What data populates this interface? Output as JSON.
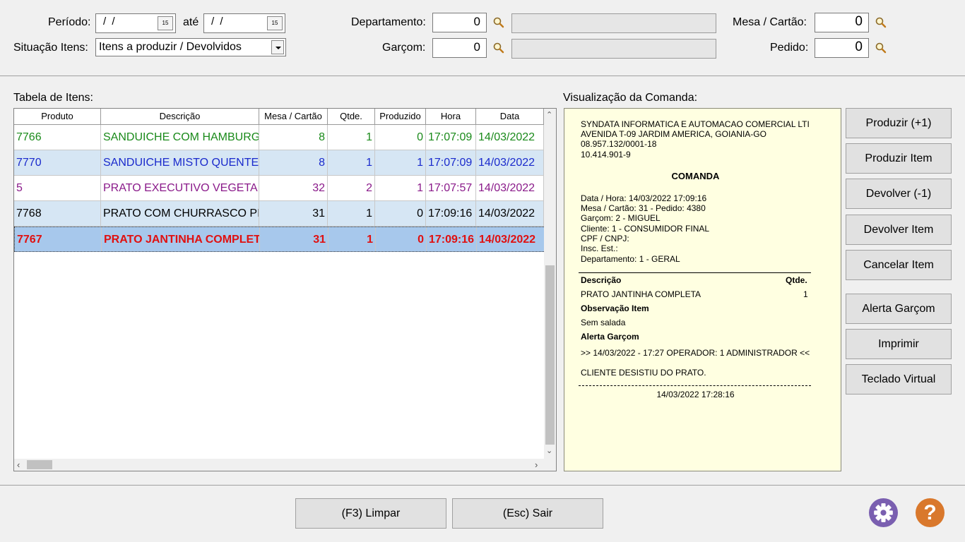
{
  "filters": {
    "periodo_label": "Período:",
    "ate_label": "até",
    "date_from": "/ /",
    "date_to": "/ /",
    "cal_icon_text": "15",
    "situacao_label": "Situação Itens:",
    "situacao_value": "Itens a produzir / Devolvidos",
    "departamento_label": "Departamento:",
    "departamento_value": "0",
    "garcom_label": "Garçom:",
    "garcom_value": "0",
    "mesa_label": "Mesa / Cartão:",
    "mesa_value": "0",
    "pedido_label": "Pedido:",
    "pedido_value": "0"
  },
  "table": {
    "title": "Tabela de Itens:",
    "columns": [
      "Produto",
      "Descrição",
      "Mesa / Cartão",
      "Qtde.",
      "Produzido",
      "Hora",
      "Data"
    ],
    "rows": [
      {
        "produto": "7766",
        "descricao": "SANDUICHE COM HAMBURGUER",
        "mesa": "8",
        "qtde": "1",
        "produzido": "0",
        "hora": "17:07:09",
        "data": "14/03/2022",
        "color": "#1a8a1a"
      },
      {
        "produto": "7770",
        "descricao": "SANDUICHE MISTO QUENTE",
        "mesa": "8",
        "qtde": "1",
        "produzido": "1",
        "hora": "17:07:09",
        "data": "14/03/2022",
        "color": "#1a2acc"
      },
      {
        "produto": "5",
        "descricao": "PRATO EXECUTIVO VEGETARIANO",
        "mesa": "32",
        "qtde": "2",
        "produzido": "1",
        "hora": "17:07:57",
        "data": "14/03/2022",
        "color": "#8a1a8a"
      },
      {
        "produto": "7768",
        "descricao": "PRATO COM CHURRASCO PICANHA",
        "mesa": "31",
        "qtde": "1",
        "produzido": "0",
        "hora": "17:09:16",
        "data": "14/03/2022",
        "color": "#000000"
      },
      {
        "produto": "7767",
        "descricao": "PRATO JANTINHA COMPLETA",
        "mesa": "31",
        "qtde": "1",
        "produzido": "0",
        "hora": "17:09:16",
        "data": "14/03/2022",
        "color": "#e01010"
      }
    ]
  },
  "comanda": {
    "title": "Visualização da Comanda:",
    "company": "SYNDATA INFORMATICA E AUTOMACAO COMERCIAL LTI",
    "address": "AVENIDA T-09 JARDIM AMERICA, GOIANIA-GO",
    "cnpj": "08.957.132/0001-18",
    "ie": "10.414.901-9",
    "heading": "COMANDA",
    "data_hora": "Data / Hora: 14/03/2022 17:09:16",
    "mesa_pedido": "Mesa / Cartão: 31 - Pedido: 4380",
    "garcom": "Garçom: 2 - MIGUEL",
    "cliente": "Cliente: 1 - CONSUMIDOR FINAL",
    "cpf": "CPF / CNPJ:",
    "insc": "Insc. Est.:",
    "departamento": "Departamento: 1 - GERAL",
    "col_desc": "Descrição",
    "col_qtde": "Qtde.",
    "item_desc": "PRATO JANTINHA COMPLETA",
    "item_qtde": "1",
    "obs_label": "Observação Item",
    "obs_value": "Sem salada",
    "alerta_label": "Alerta Garçom",
    "alerta_line": ">> 14/03/2022 - 17:27 OPERADOR: 1 ADMINISTRADOR <<",
    "alerta_msg": "CLIENTE DESISTIU DO PRATO.",
    "footer_ts": "14/03/2022 17:28:16"
  },
  "actions": {
    "produzir_mais": "Produzir (+1)",
    "produzir_item": "Produzir Item",
    "devolver_menos": "Devolver (-1)",
    "devolver_item": "Devolver Item",
    "cancelar_item": "Cancelar Item",
    "alerta_garcom": "Alerta Garçom",
    "imprimir": "Imprimir",
    "teclado_virtual": "Teclado Virtual"
  },
  "footer": {
    "limpar": "(F3) Limpar",
    "sair": "(Esc) Sair",
    "help_glyph": "?"
  },
  "colors": {
    "selected_row": "#a7c8ec",
    "alt_row": "#d6e6f4",
    "ticket_bg": "#ffffe1",
    "settings_icon": "#7a5fb0",
    "help_icon": "#d9782c"
  },
  "icons": [
    "search-icon",
    "calendar-icon",
    "chevron-down-icon",
    "gear-icon",
    "help-icon"
  ]
}
